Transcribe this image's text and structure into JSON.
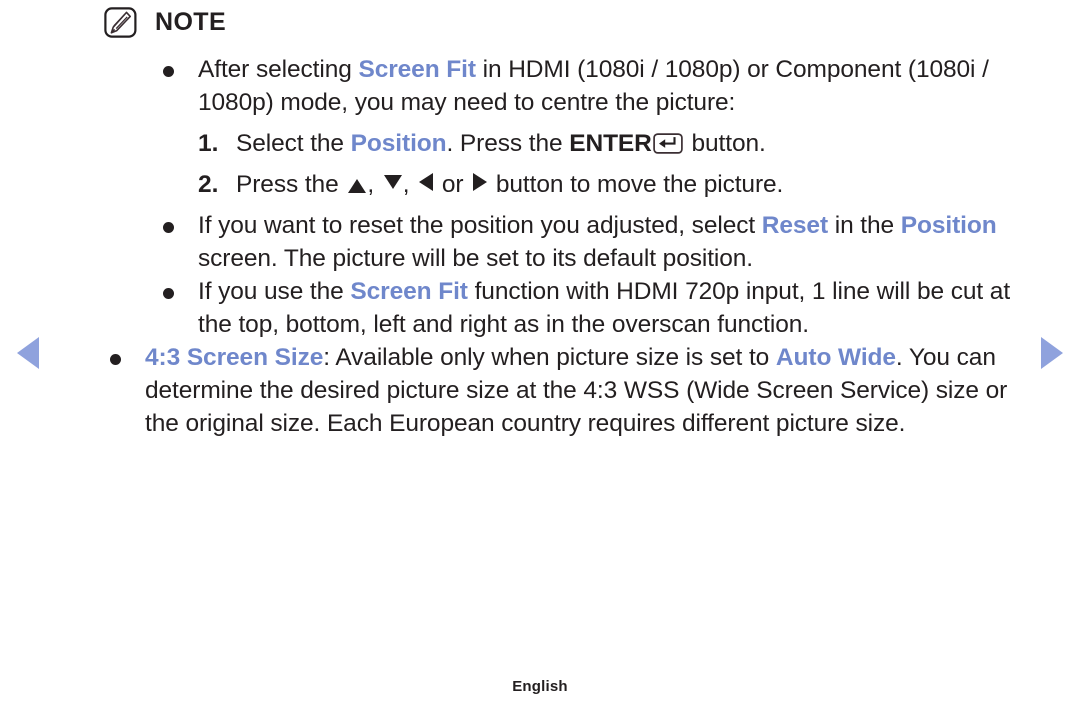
{
  "note": {
    "icon": "note-pencil-icon",
    "title": "NOTE"
  },
  "nav": {
    "prev_icon": "triangle-left-icon",
    "next_icon": "triangle-right-icon",
    "arrow_color": "#8fa2dd"
  },
  "colors": {
    "highlight_blue": "#6f87cb",
    "text_black": "#231f20",
    "background": "#ffffff"
  },
  "bullets": [
    {
      "id": "screen-fit-centre",
      "segments": [
        {
          "text": "After selecting ",
          "style": "normal"
        },
        {
          "text": "Screen Fit",
          "style": "highlight"
        },
        {
          "text": " in HDMI (1080i / 1080p) or Component (1080i / 1080p) mode, you may need to centre the picture:",
          "style": "normal"
        }
      ]
    },
    {
      "id": "reset-position",
      "segments": [
        {
          "text": "If you want to reset the position you adjusted, select ",
          "style": "normal"
        },
        {
          "text": "Reset",
          "style": "highlight"
        },
        {
          "text": " in the ",
          "style": "normal"
        },
        {
          "text": "Position",
          "style": "highlight"
        },
        {
          "text": " screen. The picture will be set to its default position.",
          "style": "normal"
        }
      ]
    },
    {
      "id": "screen-fit-720p",
      "segments": [
        {
          "text": "If you use the ",
          "style": "normal"
        },
        {
          "text": "Screen Fit",
          "style": "highlight"
        },
        {
          "text": " function with HDMI 720p input, 1 line will be cut at the top, bottom, left and right as in the overscan function.",
          "style": "normal"
        }
      ]
    },
    {
      "id": "43-screen-size",
      "segments": [
        {
          "text": "4:3 Screen Size",
          "style": "highlight"
        },
        {
          "text": ": Available only when picture size is set to ",
          "style": "normal"
        },
        {
          "text": "Auto Wide",
          "style": "highlight"
        },
        {
          "text": ". You can determine the desired picture size at the 4:3 WSS (Wide Screen Service) size or the original size. Each European country requires different picture size.",
          "style": "normal"
        }
      ]
    }
  ],
  "steps": [
    {
      "number": "1.",
      "prefix": "Select the ",
      "highlight": "Position",
      "middle": ". Press the ",
      "bold": "ENTER",
      "icon": "enter-key-icon",
      "suffix": " button."
    },
    {
      "number": "2.",
      "prefix": "Press the ",
      "arrow_up": "triangle-up-icon",
      "sep1": ", ",
      "arrow_down": "triangle-down-icon",
      "sep2": ", ",
      "arrow_left": "triangle-left-icon",
      "sep3": " or ",
      "arrow_right": "triangle-right-icon",
      "suffix": " button to move the picture."
    }
  ],
  "footer": {
    "language": "English"
  }
}
